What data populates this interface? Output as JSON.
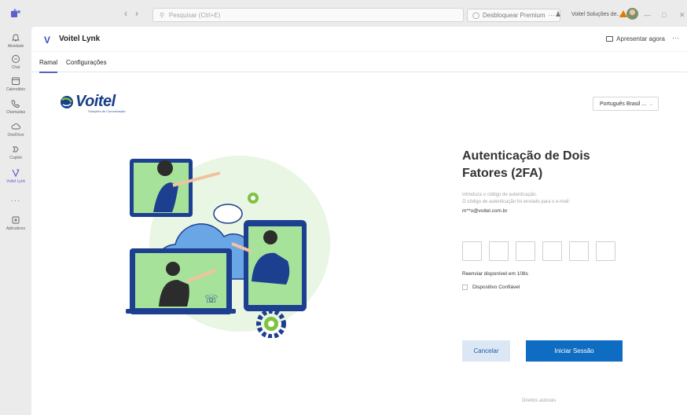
{
  "titlebar": {
    "search_placeholder": "Pesquisar (Ctrl+E)",
    "premium_label": "Desbloquear Premium",
    "org_name": "Voitel Soluções de...",
    "accent": "#5b5fc7"
  },
  "rail": {
    "items": [
      {
        "label": "Atividade",
        "icon": "bell-icon"
      },
      {
        "label": "Chat",
        "icon": "chat-icon"
      },
      {
        "label": "Calendário",
        "icon": "calendar-icon"
      },
      {
        "label": "Chamadas",
        "icon": "phone-icon"
      },
      {
        "label": "OneDrive",
        "icon": "cloud-icon"
      },
      {
        "label": "Copilot",
        "icon": "copilot-icon"
      },
      {
        "label": "Voitel Lynk",
        "icon": "voitel-icon"
      },
      {
        "label": "Aplicativos",
        "icon": "apps-icon"
      }
    ]
  },
  "app": {
    "title": "Voitel Lynk",
    "present_label": "Apresentar agora",
    "tabs": [
      "Ramal",
      "Configurações"
    ]
  },
  "page": {
    "logo_text": "Voitel",
    "logo_tagline": "Soluções de Comunicação",
    "language": "Português Brasil ...",
    "auth_title": "Autenticação de Dois Fatores (2FA)",
    "info_line1": "Introduza o código de autenticação.",
    "info_line2": "O código de autenticação foi enviado para o e-mail:",
    "email": "m**o@voitel.com.br",
    "resend": "Reenviar disponível em 108s",
    "trusted_device": "Dispositivo Confiável",
    "cancel_label": "Cancelar",
    "login_label": "Iniciar Sessão",
    "copyright": "Direitos autorais",
    "primary_color": "#0e6cc2"
  }
}
